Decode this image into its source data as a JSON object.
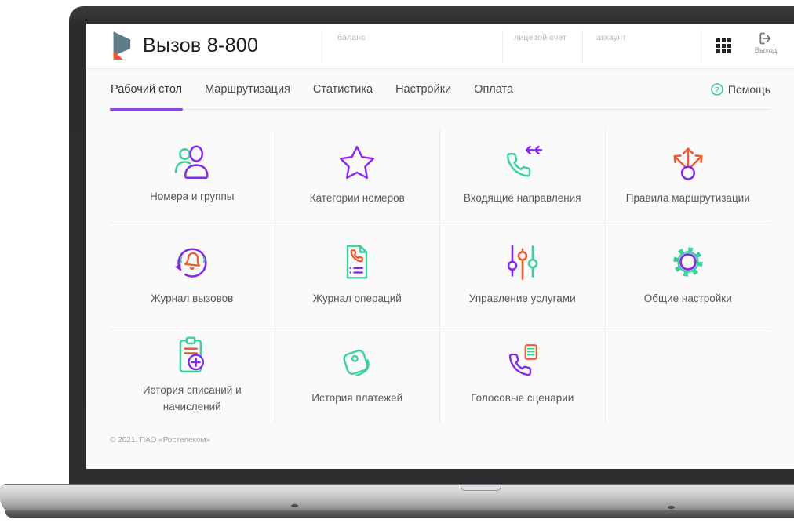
{
  "app": {
    "title": "Вызов 8-800",
    "logo_icon": "vyzov-ribbon-logo"
  },
  "header": {
    "account_fields": [
      {
        "label": "баланс"
      },
      {
        "label": "лицевой счет"
      },
      {
        "label": "аккаунт"
      }
    ],
    "apps_icon": "apps-grid-icon",
    "logout": {
      "label": "Выход",
      "icon": "logout-icon"
    }
  },
  "nav": {
    "tabs": [
      {
        "label": "Рабочий стол",
        "active": true
      },
      {
        "label": "Маршрутизация",
        "active": false
      },
      {
        "label": "Статистика",
        "active": false
      },
      {
        "label": "Настройки",
        "active": false
      },
      {
        "label": "Оплата",
        "active": false
      }
    ],
    "help": {
      "label": "Помощь",
      "icon": "help-question-icon"
    }
  },
  "tiles": [
    {
      "label": "Номера и группы",
      "icon": "users-icon"
    },
    {
      "label": "Категории номеров",
      "icon": "star-icon"
    },
    {
      "label": "Входящие направления",
      "icon": "incoming-call-icon"
    },
    {
      "label": "Правила маршрутизации",
      "icon": "routing-arrows-icon"
    },
    {
      "label": "Журнал вызовов",
      "icon": "call-log-icon"
    },
    {
      "label": "Журнал операций",
      "icon": "operations-log-icon"
    },
    {
      "label": "Управление услугами",
      "icon": "sliders-icon"
    },
    {
      "label": "Общие настройки",
      "icon": "gear-icon"
    },
    {
      "label": "История списаний и начислений",
      "icon": "clipboard-plus-icon"
    },
    {
      "label": "История платежей",
      "icon": "wallet-icon"
    },
    {
      "label": "Голосовые сценарии",
      "icon": "voice-script-icon"
    }
  ],
  "footer": {
    "copyright": "© 2021. ПАО «Ростелеком»"
  },
  "colors": {
    "purple": "#8627ea",
    "teal": "#3ecf9f",
    "orange": "#f0592b",
    "logo_slate": "#5d7b89",
    "logo_orange": "#f1552b",
    "active_tab_underline": "#9046e0"
  }
}
